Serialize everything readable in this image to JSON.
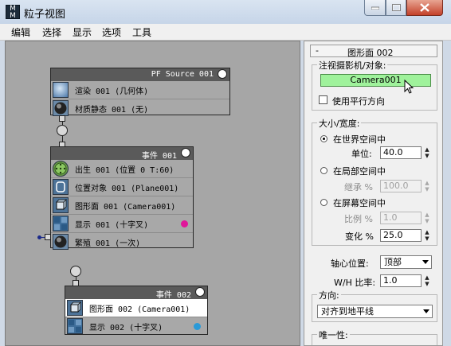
{
  "window": {
    "title": "粒子视图",
    "app_icon_text": "M",
    "controls": {
      "minimize": "minimize",
      "maximize": "maximize",
      "close": "close"
    }
  },
  "menu": [
    "编辑",
    "选择",
    "显示",
    "选项",
    "工具"
  ],
  "graph": {
    "nodes": [
      {
        "title": "PF Source 001",
        "operators": [
          {
            "label": "渲染 001 (几何体)",
            "icon": "render-icon"
          },
          {
            "label": "材质静态 001 (无)",
            "icon": "material-static-icon"
          }
        ]
      },
      {
        "title": "事件 001",
        "operators": [
          {
            "label": "出生 001 (位置 0 T:60)",
            "icon": "birth-icon"
          },
          {
            "label": "位置对象 001 (Plane001)",
            "icon": "position-object-icon"
          },
          {
            "label": "图形面 001 (Camera001)",
            "icon": "shape-facing-icon"
          },
          {
            "label": "显示 001 (十字叉)",
            "icon": "display-icon",
            "dot_color": "#e0169a"
          },
          {
            "label": "繁殖 001 (一次)",
            "icon": "spawn-icon"
          }
        ]
      },
      {
        "title": "事件 002",
        "operators": [
          {
            "label": "图形面 002 (Camera001)",
            "icon": "shape-facing-icon",
            "selected": true
          },
          {
            "label": "显示 002 (十字叉)",
            "icon": "display-icon",
            "dot_color": "#2a9ad8"
          }
        ]
      }
    ]
  },
  "panel": {
    "rollout_toggle": "-",
    "rollout_title": "图形面 002",
    "look_at": {
      "group_label": "注视摄影机/对象:",
      "camera_button": "Camera001",
      "parallel_label": "使用平行方向",
      "parallel_checked": false
    },
    "size": {
      "group_label": "大小/宽度:",
      "world_space_label": "在世界空间中",
      "world_space_selected": true,
      "units_label": "单位:",
      "units_value": "40.0",
      "local_space_label": "在局部空间中",
      "inherit_label": "继承 %",
      "inherit_value": "100.0",
      "screen_space_label": "在屏幕空间中",
      "proportion_label": "比例 %",
      "proportion_value": "1.0",
      "variation_label": "变化 %",
      "variation_value": "25.0"
    },
    "pivot": {
      "label": "轴心位置:",
      "value": "顶部"
    },
    "wh_ratio": {
      "label": "W/H 比率:",
      "value": "1.0"
    },
    "orientation": {
      "group_label": "方向:",
      "value": "对齐到地平线"
    },
    "uniqueness": {
      "group_label": "唯一性:"
    }
  }
}
